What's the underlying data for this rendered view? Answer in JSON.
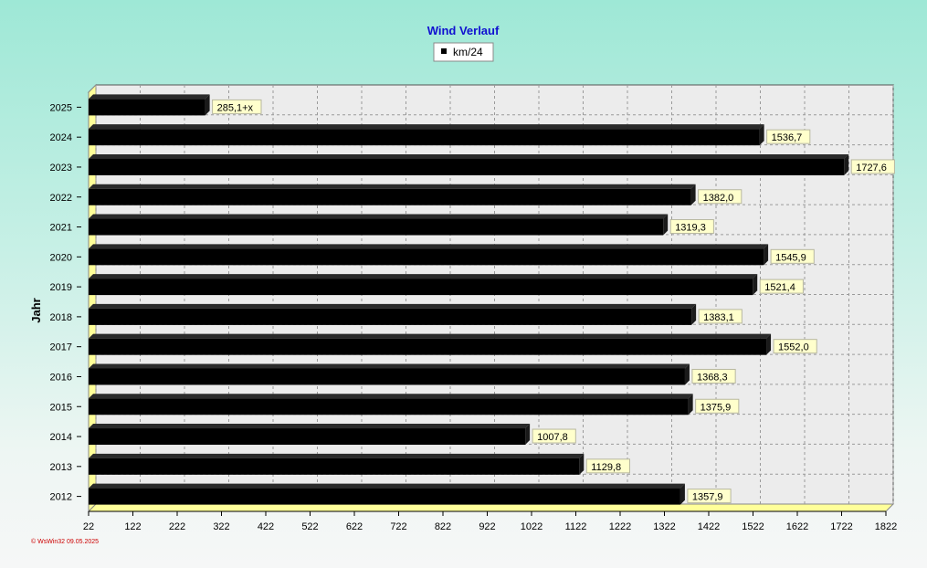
{
  "colors": {
    "plot_bg": "#ececec",
    "bar": "#000000",
    "label_bg": "#ffffcc",
    "floor": "#ffff99",
    "grid": "#9a9a9a",
    "title": "#1010d0",
    "footer": "#cc0000"
  },
  "footer": "© WsWin32  09.05.2025",
  "chart_data": {
    "type": "bar",
    "orientation": "horizontal",
    "title": "Wind Verlauf",
    "ylabel": "Jahr",
    "xlabel": "",
    "legend": {
      "position": "top-center",
      "entries": [
        "km/24"
      ]
    },
    "grid": true,
    "xlim": [
      22,
      1822
    ],
    "x_ticks": [
      22,
      122,
      222,
      322,
      422,
      522,
      622,
      722,
      822,
      922,
      1022,
      1122,
      1222,
      1322,
      1422,
      1522,
      1622,
      1722,
      1822
    ],
    "categories": [
      "2025",
      "2024",
      "2023",
      "2022",
      "2021",
      "2020",
      "2019",
      "2018",
      "2017",
      "2016",
      "2015",
      "2014",
      "2013",
      "2012"
    ],
    "series": [
      {
        "name": "km/24",
        "values": [
          285.1,
          1536.7,
          1727.6,
          1382.0,
          1319.3,
          1545.9,
          1521.4,
          1383.1,
          1552.0,
          1368.3,
          1375.9,
          1007.8,
          1129.8,
          1357.9
        ],
        "labels": [
          "285,1+x",
          "1536,7",
          "1727,6",
          "1382,0",
          "1319,3",
          "1545,9",
          "1521,4",
          "1383,1",
          "1552,0",
          "1368,3",
          "1375,9",
          "1007,8",
          "1129,8",
          "1357,9"
        ]
      }
    ]
  }
}
